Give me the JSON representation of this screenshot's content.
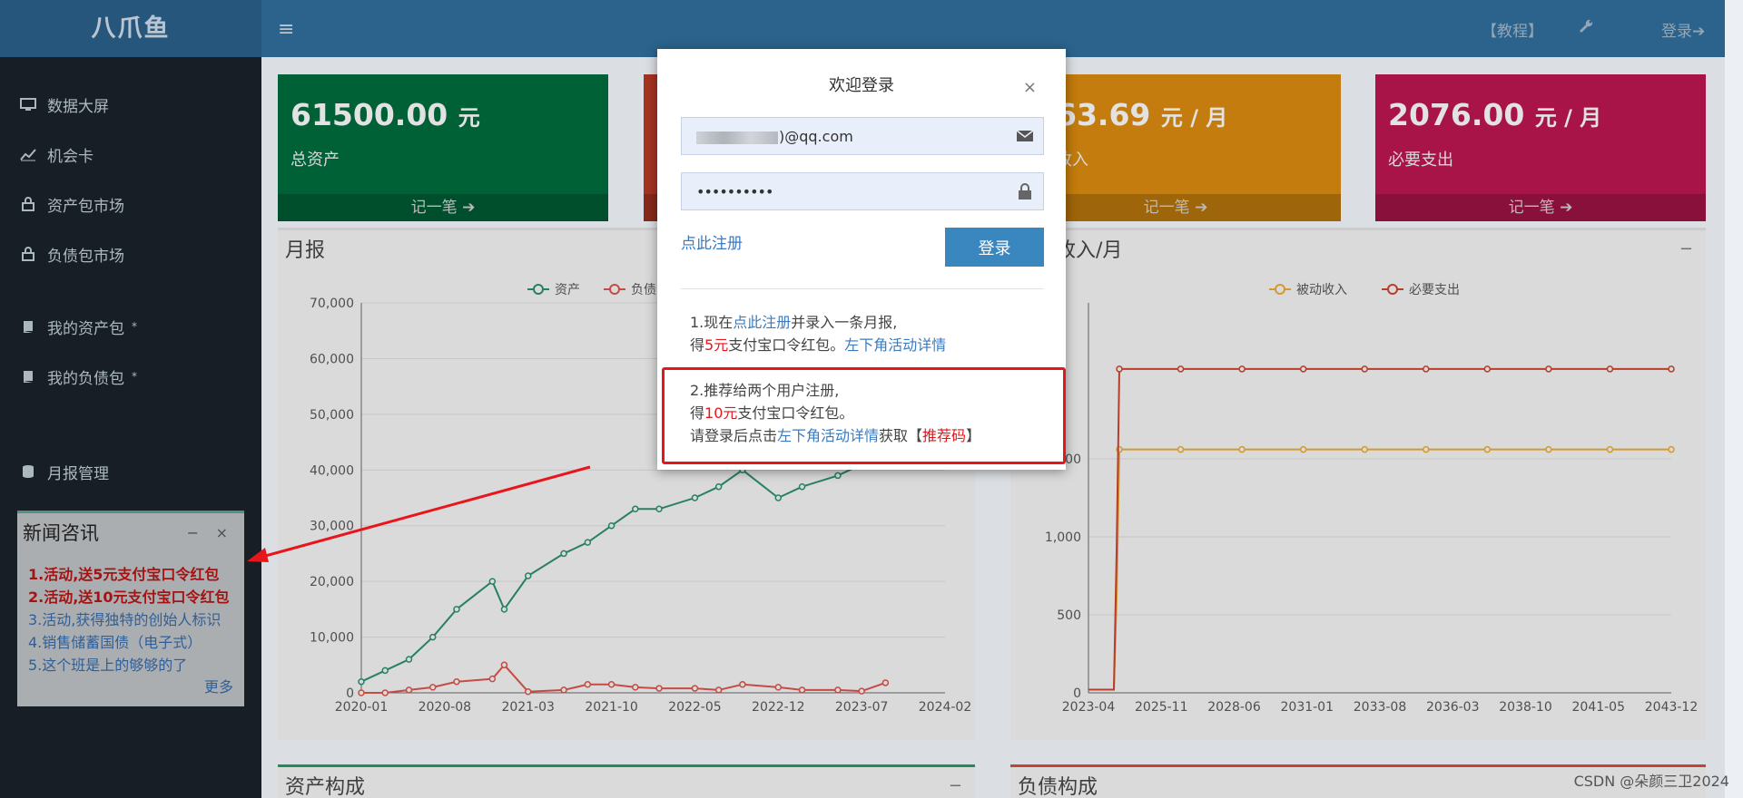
{
  "app": {
    "logo": "八爪鱼"
  },
  "topbar": {
    "menu_icon": "hamburger-icon",
    "tutorial": "【教程】",
    "tool_icon": "wrench-icon",
    "login": "登录",
    "login_icon": "sign-in-icon"
  },
  "sidebar": {
    "items": [
      {
        "label": "数据大屏",
        "icon": "desktop-icon"
      },
      {
        "label": "机会卡",
        "icon": "line-chart-icon"
      },
      {
        "label": "资产包市场",
        "icon": "lock-icon"
      },
      {
        "label": "负债包市场",
        "icon": "lock-icon"
      },
      {
        "label": "我的资产包",
        "icon": "book-icon",
        "mark": "*"
      },
      {
        "label": "我的负债包",
        "icon": "book-icon",
        "mark": "*"
      },
      {
        "label": "月报管理",
        "icon": "database-icon"
      }
    ]
  },
  "news": {
    "title": "新闻咨讯",
    "minimize": "−",
    "close": "×",
    "items": [
      "1.活动,送5元支付宝口令红包",
      "2.活动,送10元支付宝口令红包",
      "3.活动,获得独特的创始人标识",
      "4.销售储蓄国债（电子式）",
      "5.这个班是上的够够的了"
    ],
    "more": "更多"
  },
  "cards": [
    {
      "value": "61500.00",
      "unit": "元",
      "label": "总资产",
      "footer": "记一笔 ➔",
      "color": "#00693b"
    },
    {
      "value": "",
      "unit": "",
      "label": "",
      "footer": "",
      "color": "#b23724"
    },
    {
      "value": "63.69",
      "unit": "元 / 月",
      "label": "收入",
      "footer": "记一笔 ➔",
      "color": "#d2860e"
    },
    {
      "value": "2076.00",
      "unit": "元 / 月",
      "label": "必要支出",
      "footer": "记一笔 ➔",
      "color": "#b5164d"
    }
  ],
  "panels": {
    "monthly": {
      "title": "月报",
      "min": "−"
    },
    "income": {
      "title": "收入/月",
      "min": "−"
    },
    "asset_comp": {
      "title": "资产构成",
      "min": "−"
    },
    "debt_comp": {
      "title": "负债构成"
    }
  },
  "modal": {
    "title": "欢迎登录",
    "close": "×",
    "email_suffix": ")@qq.com",
    "password_mask": "••••••••••",
    "register": "点此注册",
    "login_button": "登录",
    "promo1": {
      "p1": "1.现在",
      "link1": "点此注册",
      "p2": "并录入一条月报,",
      "p3": "得",
      "amount": "5元",
      "p4": "支付宝口令红包。",
      "link2": "左下角活动详情"
    },
    "promo2": {
      "p1": "2.推荐给两个用户注册,",
      "p2": "得",
      "amount": "10元",
      "p3": "支付宝口令红包。",
      "p4": "请登录后点击",
      "link": "左下角活动详情",
      "p5": "获取【",
      "code": "推荐码",
      "p6": "】"
    }
  },
  "watermark": "CSDN @朵颜三卫2024",
  "chart_data": [
    {
      "type": "line",
      "legend": [
        "资产",
        "负债"
      ],
      "x": [
        "2020-01",
        "2020-03",
        "2020-05",
        "2020-07",
        "2020-09",
        "2020-12",
        "2021-01",
        "2021-03",
        "2021-06",
        "2021-08",
        "2021-10",
        "2021-12",
        "2022-02",
        "2022-05",
        "2022-07",
        "2022-09",
        "2022-12",
        "2023-02",
        "2023-05",
        "2023-07",
        "2023-09"
      ],
      "xticks": [
        "2020-01",
        "2020-08",
        "2021-03",
        "2021-10",
        "2022-05",
        "2022-12",
        "2023-07",
        "2024-02"
      ],
      "series": [
        {
          "name": "资产",
          "color": "#2a8a6e",
          "values": [
            2000,
            4000,
            6000,
            10000,
            15000,
            20000,
            15000,
            21000,
            25000,
            27000,
            30000,
            33000,
            33000,
            35000,
            37000,
            40000,
            35000,
            37000,
            39000,
            41000,
            43000
          ]
        },
        {
          "name": "负债",
          "color": "#d4514a",
          "values": [
            0,
            0,
            500,
            1000,
            2000,
            2500,
            5000,
            200,
            500,
            1500,
            1500,
            1000,
            800,
            800,
            500,
            1500,
            1000,
            500,
            500,
            300,
            1800
          ]
        }
      ],
      "ylim": [
        0,
        70000
      ],
      "yticks": [
        "0",
        "10,000",
        "20,000",
        "30,000",
        "40,000",
        "50,000",
        "60,000",
        "70,000"
      ]
    },
    {
      "type": "line",
      "legend": [
        "被动收入",
        "必要支出"
      ],
      "xticks": [
        "2023-04",
        "2025-11",
        "2028-06",
        "2031-01",
        "2033-08",
        "2036-03",
        "2038-10",
        "2041-05",
        "2043-12"
      ],
      "series": [
        {
          "name": "被动收入",
          "color": "#e2a636",
          "plateau": 1560
        },
        {
          "name": "必要支出",
          "color": "#c6422f",
          "plateau": 2076
        }
      ],
      "ylim": [
        0,
        2500
      ],
      "yticks": [
        "0",
        "500",
        "1,000",
        "1,500"
      ]
    }
  ]
}
